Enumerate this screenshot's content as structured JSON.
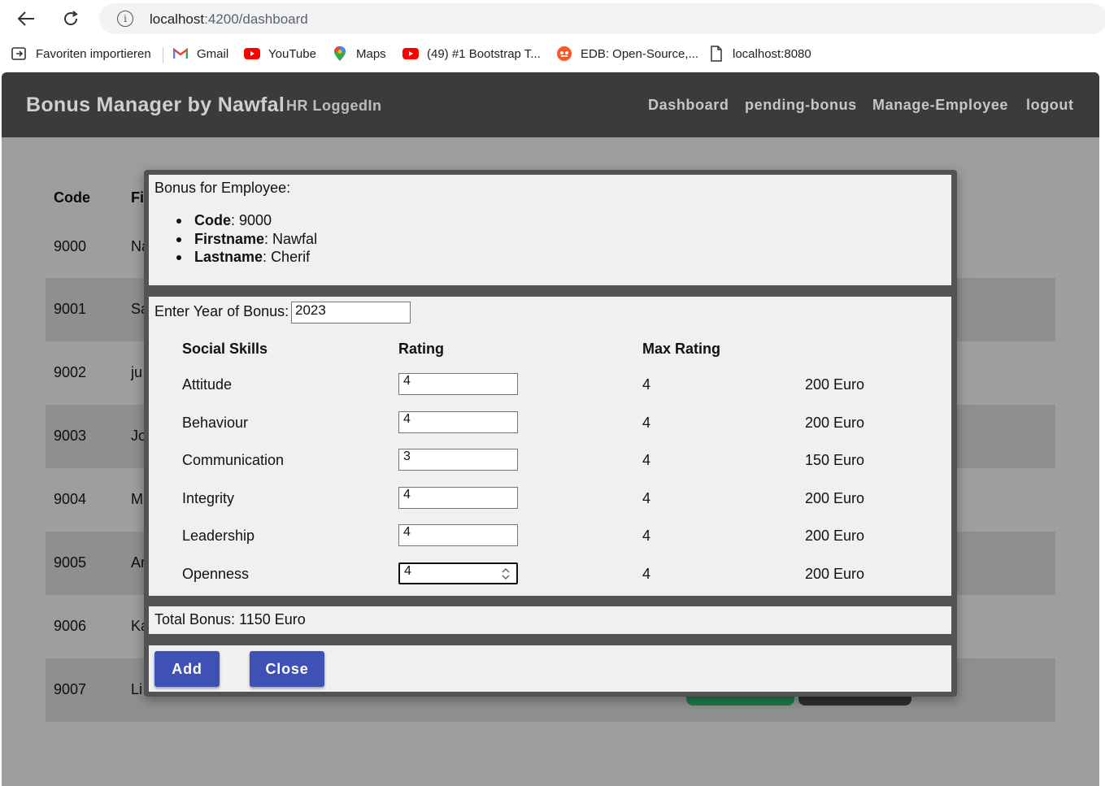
{
  "browser": {
    "url_host": "localhost",
    "url_path": ":4200/dashboard",
    "bookmarks": [
      {
        "label": "Favoriten importieren",
        "icon": "import-favorites-icon"
      },
      {
        "label": "Gmail",
        "icon": "gmail-icon"
      },
      {
        "label": "YouTube",
        "icon": "youtube-icon"
      },
      {
        "label": "Maps",
        "icon": "maps-icon"
      },
      {
        "label": "(49) #1 Bootstrap T...",
        "icon": "youtube-icon"
      },
      {
        "label": "EDB: Open-Source,...",
        "icon": "edb-icon"
      },
      {
        "label": "localhost:8080",
        "icon": "page-icon"
      }
    ]
  },
  "navbar": {
    "brand": "Bonus Manager by Nawfal",
    "status": "HR LoggedIn",
    "links": [
      "Dashboard",
      "pending-bonus",
      "Manage-Employee",
      "logout"
    ]
  },
  "table": {
    "headers": [
      "Code",
      "Fi"
    ],
    "rows": [
      {
        "code": "9000",
        "first": "Na"
      },
      {
        "code": "9001",
        "first": "Sa"
      },
      {
        "code": "9002",
        "first": "ju"
      },
      {
        "code": "9003",
        "first": "Jo"
      },
      {
        "code": "9004",
        "first": "M"
      },
      {
        "code": "9005",
        "first": "Ar"
      },
      {
        "code": "9006",
        "first": "Ka"
      },
      {
        "code": "9007",
        "first": "Li"
      }
    ]
  },
  "modal": {
    "title": "Bonus for Employee:",
    "employee": {
      "code_label": "Code",
      "code": "9000",
      "firstname_label": "Firstname",
      "firstname": "Nawfal",
      "lastname_label": "Lastname",
      "lastname": "Cherif"
    },
    "year_label": "Enter Year of Bonus:",
    "year_value": "2023",
    "columns": {
      "skills": "Social Skills",
      "rating": "Rating",
      "max": "Max Rating"
    },
    "skills": [
      {
        "name": "Attitude",
        "rating": "4",
        "max": "4",
        "bonus": "200 Euro"
      },
      {
        "name": "Behaviour",
        "rating": "4",
        "max": "4",
        "bonus": "200 Euro"
      },
      {
        "name": "Communication",
        "rating": "3",
        "max": "4",
        "bonus": "150 Euro"
      },
      {
        "name": "Integrity",
        "rating": "4",
        "max": "4",
        "bonus": "200 Euro"
      },
      {
        "name": "Leadership",
        "rating": "4",
        "max": "4",
        "bonus": "200 Euro"
      },
      {
        "name": "Openness",
        "rating": "4",
        "max": "4",
        "bonus": "200 Euro"
      }
    ],
    "total": "Total Bonus: 1150 Euro",
    "add_label": "Add",
    "close_label": "Close"
  },
  "colors": {
    "navbar": "#3b3b3b",
    "overlay": "#9e9e9e",
    "primary_button": "#3f51b5"
  }
}
